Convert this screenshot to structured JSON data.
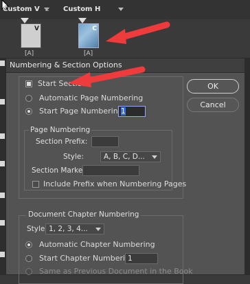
{
  "pages_panel": {
    "masters": [
      {
        "name": "Custom V"
      },
      {
        "name": "Custom H"
      }
    ],
    "thumbnails": [
      {
        "tag": "V",
        "label": "[A]"
      },
      {
        "tag": "C",
        "label": "[A]"
      }
    ]
  },
  "dialog": {
    "title": "Numbering & Section Options",
    "start_section_label": "Start Section",
    "auto_page_numbering_label": "Automatic Page Numbering",
    "start_page_numbering_label": "Start Page Numbering at:",
    "start_page_value": "1",
    "page_numbering": {
      "heading": "Page Numbering",
      "section_prefix_label": "Section Prefix:",
      "section_prefix_value": "",
      "style_label": "Style:",
      "style_value": "A, B, C, D...",
      "section_marker_label": "Section Marker:",
      "section_marker_value": "",
      "include_prefix_label": "Include Prefix when Numbering Pages"
    },
    "chapter_numbering": {
      "heading": "Document Chapter Numbering",
      "style_label": "Style:",
      "style_value": "1, 2, 3, 4...",
      "auto_chapter_label": "Automatic Chapter Numbering",
      "start_chapter_label": "Start Chapter Numbering at:",
      "start_chapter_value": "1",
      "same_as_previous_label": "Same as Previous Document in the Book"
    },
    "buttons": {
      "ok": "OK",
      "cancel": "Cancel"
    }
  },
  "colors": {
    "annotation_arrow": "#ef3b3b",
    "focus_highlight": "#3d6fd8"
  }
}
